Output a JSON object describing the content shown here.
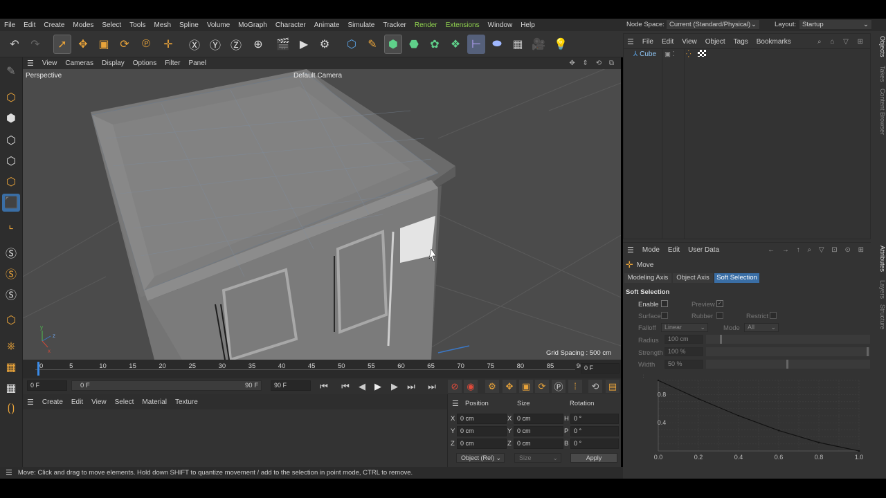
{
  "menubar": {
    "items": [
      "File",
      "Edit",
      "Create",
      "Modes",
      "Select",
      "Tools",
      "Mesh",
      "Spline",
      "Volume",
      "MoGraph",
      "Character",
      "Animate",
      "Simulate",
      "Tracker",
      "Render",
      "Extensions",
      "Window",
      "Help"
    ],
    "highlight_index": [
      14,
      15
    ]
  },
  "header_right": {
    "node_space_label": "Node Space:",
    "node_space_value": "Current (Standard/Physical)",
    "layout_label": "Layout:",
    "layout_value": "Startup"
  },
  "toolbar": {
    "icons": [
      "undo-icon",
      "redo-icon",
      "live-selection-icon",
      "move-icon",
      "scale-icon",
      "rotate-icon",
      "recent-tools-icon",
      "axis-lock-icon",
      "x-axis-icon",
      "y-axis-icon",
      "z-axis-icon",
      "coordinate-system-icon",
      "render-view-icon",
      "render-picture-viewer-icon",
      "render-settings-icon",
      "cube-object-icon",
      "pen-tool-icon",
      "subdivision-icon",
      "extrude-icon",
      "mograph-cloner-icon",
      "array-icon",
      "deformer-icon",
      "field-icon",
      "floor-icon",
      "camera-icon",
      "light-icon"
    ]
  },
  "viewport": {
    "menu": [
      "View",
      "Cameras",
      "Display",
      "Options",
      "Filter",
      "Panel"
    ],
    "view_name": "Perspective",
    "camera_name": "Default Camera",
    "grid_spacing": "Grid Spacing : 500 cm"
  },
  "timeline": {
    "ticks": [
      "0",
      "5",
      "10",
      "15",
      "20",
      "25",
      "30",
      "35",
      "40",
      "45",
      "50",
      "55",
      "60",
      "65",
      "70",
      "75",
      "80",
      "85",
      "90"
    ],
    "current_frame": "0 F",
    "start_frame": "0 F",
    "range_start": "0 F",
    "range_end": "90 F",
    "end_frame": "90 F"
  },
  "material_panel": {
    "menu": [
      "Create",
      "Edit",
      "View",
      "Select",
      "Material",
      "Texture"
    ]
  },
  "coordinates": {
    "headers": [
      "Position",
      "Size",
      "Rotation"
    ],
    "rows": [
      {
        "axis": "X",
        "pos": "0 cm",
        "saxis": "X",
        "size": "0 cm",
        "raxis": "H",
        "rot": "0 °"
      },
      {
        "axis": "Y",
        "pos": "0 cm",
        "saxis": "Y",
        "size": "0 cm",
        "raxis": "P",
        "rot": "0 °"
      },
      {
        "axis": "Z",
        "pos": "0 cm",
        "saxis": "Z",
        "size": "0 cm",
        "raxis": "B",
        "rot": "0 °"
      }
    ],
    "mode": "Object (Rel)",
    "size_mode": "Size",
    "apply_label": "Apply"
  },
  "status": "Move: Click and drag to move elements. Hold down SHIFT to quantize movement / add to the selection in point mode, CTRL to remove.",
  "object_manager": {
    "menu": [
      "File",
      "Edit",
      "View",
      "Object",
      "Tags",
      "Bookmarks"
    ],
    "objects": [
      {
        "name": "Cube"
      }
    ]
  },
  "attributes": {
    "menu": [
      "Mode",
      "Edit",
      "User Data"
    ],
    "tool_name": "Move",
    "tabs": [
      "Modeling Axis",
      "Object Axis",
      "Soft Selection"
    ],
    "active_tab": "Soft Selection",
    "section_title": "Soft Selection",
    "enable_label": "Enable",
    "preview_label": "Preview",
    "surface_label": "Surface",
    "rubber_label": "Rubber",
    "restrict_label": "Restrict",
    "falloff_label": "Falloff",
    "falloff_value": "Linear",
    "mode_label": "Mode",
    "mode_value": "All",
    "radius_label": "Radius",
    "radius_value": "100 cm",
    "strength_label": "Strength",
    "strength_value": "100 %",
    "width_label": "Width",
    "width_value": "50 %"
  },
  "side_tabs": {
    "top": [
      "Objects",
      "Takes",
      "Content Browser"
    ],
    "bottom": [
      "Attributes",
      "Layers",
      "Structure"
    ]
  },
  "chart_data": {
    "type": "line",
    "x": [
      0.0,
      0.2,
      0.4,
      0.6,
      0.8,
      1.0
    ],
    "y": [
      1.0,
      0.74,
      0.5,
      0.29,
      0.12,
      0.0
    ],
    "xticks": [
      "0.0",
      "0.2",
      "0.4",
      "0.6",
      "0.8",
      "1.0"
    ],
    "yticks": [
      "0.4",
      "0.8"
    ],
    "xlim": [
      0,
      1
    ],
    "ylim": [
      0,
      1
    ],
    "grid": true
  },
  "colors": {
    "accent_green": "#8fd14f",
    "active_blue": "#3a6ea5",
    "active_tool_orange": "#f0a22e"
  }
}
